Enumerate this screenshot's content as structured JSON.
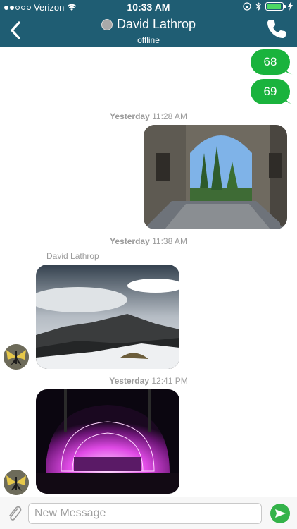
{
  "status_bar": {
    "carrier": "Verizon",
    "time": "10:33 AM",
    "battery_level": 0.92,
    "battery_color": "#4cd964"
  },
  "header": {
    "contact_name": "David Lathrop",
    "contact_status": "offline",
    "background": "#1f5d73",
    "back_icon": "chevron-left-icon",
    "call_icon": "phone-icon"
  },
  "messages": {
    "sent_1": "68",
    "sent_2": "69",
    "sent_color": "#1ab33d",
    "group_1": {
      "day": "Yesterday",
      "time": "11:28 AM"
    },
    "group_2": {
      "day": "Yesterday",
      "time": "11:38 AM",
      "sender": "David Lathrop"
    },
    "group_3": {
      "day": "Yesterday",
      "time": "12:41 PM"
    }
  },
  "composer": {
    "placeholder": "New Message",
    "attach_icon": "paperclip-icon",
    "send_icon": "send-arrow-icon",
    "send_color": "#34b34a"
  }
}
